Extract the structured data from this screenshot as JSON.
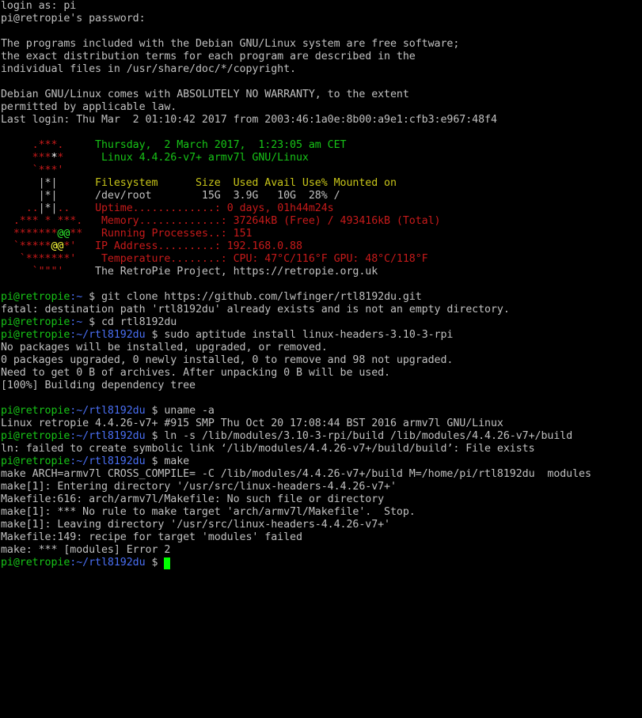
{
  "colors": {
    "background": "#000000",
    "text": "#c0c0c0",
    "prompt_user": "#17c417",
    "prompt_path": "#4a6ff4",
    "logo_red": "#c61a1a",
    "header_yellow": "#c7c419",
    "cursor": "#00ff00"
  },
  "terminal": {
    "lines": [
      [
        {
          "t": "login as: pi",
          "c": "gray"
        }
      ],
      [
        {
          "t": "pi@retropie's password:",
          "c": "gray"
        }
      ],
      [],
      [
        {
          "t": "The programs included with the Debian GNU/Linux system are free software;",
          "c": "gray"
        }
      ],
      [
        {
          "t": "the exact distribution terms for each program are described in the",
          "c": "gray"
        }
      ],
      [
        {
          "t": "individual files in /usr/share/doc/*/copyright.",
          "c": "gray"
        }
      ],
      [],
      [
        {
          "t": "Debian GNU/Linux comes with ABSOLUTELY NO WARRANTY, to the extent",
          "c": "gray"
        }
      ],
      [
        {
          "t": "permitted by applicable law.",
          "c": "gray"
        }
      ],
      [
        {
          "t": "Last login: Thu Mar  2 01:10:42 2017 from 2003:46:1a0e:8b00:a9e1:cfb3:e967:48f4",
          "c": "gray"
        }
      ],
      [],
      [
        {
          "t": "     .***.     ",
          "c": "red"
        },
        {
          "t": "Thursday,  2 March 2017,  1:23:05 am CET",
          "c": "green"
        }
      ],
      [
        {
          "t": "     ***",
          "c": "red"
        },
        {
          "t": "*",
          "c": "white"
        },
        {
          "t": "*      ",
          "c": "red"
        },
        {
          "t": "Linux 4.4.26-v7+ armv7l GNU/Linux",
          "c": "green"
        }
      ],
      [
        {
          "t": "     `***'",
          "c": "red"
        }
      ],
      [
        {
          "t": "      |*|      ",
          "c": "gray"
        },
        {
          "t": "Filesystem      Size  Used Avail Use% Mounted on",
          "c": "yellow"
        }
      ],
      [
        {
          "t": "      |*|      ",
          "c": "gray"
        },
        {
          "t": "/dev/root        15G  3.9G   10G  28% /",
          "c": "gray"
        }
      ],
      [
        {
          "t": "    ..",
          "c": "red"
        },
        {
          "t": "|*|",
          "c": "gray"
        },
        {
          "t": "..    ",
          "c": "red"
        },
        {
          "t": "Uptime.............: 0 days, 01h44m24s",
          "c": "red"
        }
      ],
      [
        {
          "t": "  .*** * ***.   ",
          "c": "red"
        },
        {
          "t": "Memory.............: 37264kB (Free) / 493416kB (Total)",
          "c": "red"
        }
      ],
      [
        {
          "t": "  *******",
          "c": "red"
        },
        {
          "t": "@@",
          "c": "bgreen"
        },
        {
          "t": "**   ",
          "c": "red"
        },
        {
          "t": "Running Processes..: 151",
          "c": "red"
        }
      ],
      [
        {
          "t": "  `*****",
          "c": "red"
        },
        {
          "t": "@@",
          "c": "byellow"
        },
        {
          "t": "*'   ",
          "c": "red"
        },
        {
          "t": "IP Address.........: 192.168.0.88",
          "c": "red"
        }
      ],
      [
        {
          "t": "   `*******'    ",
          "c": "red"
        },
        {
          "t": "Temperature........: CPU: 47°C/116°F GPU: 48°C/118°F",
          "c": "red"
        }
      ],
      [
        {
          "t": "     `\"\"\"'     ",
          "c": "red"
        },
        {
          "t": "The RetroPie Project, https://retropie.org.uk",
          "c": "gray"
        }
      ],
      [],
      [
        {
          "t": "pi@retropie",
          "c": "green"
        },
        {
          "t": ":~ ",
          "c": "blue"
        },
        {
          "t": "$ git clone https://github.com/lwfinger/rtl8192du.git",
          "c": "gray"
        }
      ],
      [
        {
          "t": "fatal: destination path 'rtl8192du' already exists and is not an empty directory.",
          "c": "gray"
        }
      ],
      [
        {
          "t": "pi@retropie",
          "c": "green"
        },
        {
          "t": ":~ ",
          "c": "blue"
        },
        {
          "t": "$ cd rtl8192du",
          "c": "gray"
        }
      ],
      [
        {
          "t": "pi@retropie",
          "c": "green"
        },
        {
          "t": ":~/rtl8192du ",
          "c": "blue"
        },
        {
          "t": "$ sudo aptitude install linux-headers-3.10-3-rpi",
          "c": "gray"
        }
      ],
      [
        {
          "t": "No packages will be installed, upgraded, or removed.",
          "c": "gray"
        }
      ],
      [
        {
          "t": "0 packages upgraded, 0 newly installed, 0 to remove and 98 not upgraded.",
          "c": "gray"
        }
      ],
      [
        {
          "t": "Need to get 0 B of archives. After unpacking 0 B will be used.",
          "c": "gray"
        }
      ],
      [
        {
          "t": "[100%] Building dependency tree",
          "c": "gray"
        }
      ],
      [],
      [
        {
          "t": "pi@retropie",
          "c": "green"
        },
        {
          "t": ":~/rtl8192du ",
          "c": "blue"
        },
        {
          "t": "$ uname -a",
          "c": "gray"
        }
      ],
      [
        {
          "t": "Linux retropie 4.4.26-v7+ #915 SMP Thu Oct 20 17:08:44 BST 2016 armv7l GNU/Linux",
          "c": "gray"
        }
      ],
      [
        {
          "t": "pi@retropie",
          "c": "green"
        },
        {
          "t": ":~/rtl8192du ",
          "c": "blue"
        },
        {
          "t": "$ ln -s /lib/modules/3.10-3-rpi/build /lib/modules/4.4.26-v7+/build",
          "c": "gray"
        }
      ],
      [
        {
          "t": "ln: failed to create symbolic link ‘/lib/modules/4.4.26-v7+/build/build’: File exists",
          "c": "gray"
        }
      ],
      [
        {
          "t": "pi@retropie",
          "c": "green"
        },
        {
          "t": ":~/rtl8192du ",
          "c": "blue"
        },
        {
          "t": "$ make",
          "c": "gray"
        }
      ],
      [
        {
          "t": "make ARCH=armv7l CROSS_COMPILE= -C /lib/modules/4.4.26-v7+/build M=/home/pi/rtl8192du  modules",
          "c": "gray"
        }
      ],
      [
        {
          "t": "make[1]: Entering directory '/usr/src/linux-headers-4.4.26-v7+'",
          "c": "gray"
        }
      ],
      [
        {
          "t": "Makefile:616: arch/armv7l/Makefile: No such file or directory",
          "c": "gray"
        }
      ],
      [
        {
          "t": "make[1]: *** No rule to make target 'arch/armv7l/Makefile'.  Stop.",
          "c": "gray"
        }
      ],
      [
        {
          "t": "make[1]: Leaving directory '/usr/src/linux-headers-4.4.26-v7+'",
          "c": "gray"
        }
      ],
      [
        {
          "t": "Makefile:149: recipe for target 'modules' failed",
          "c": "gray"
        }
      ],
      [
        {
          "t": "make: *** [modules] Error 2",
          "c": "gray"
        }
      ],
      [
        {
          "t": "pi@retropie",
          "c": "green"
        },
        {
          "t": ":~/rtl8192du ",
          "c": "blue"
        },
        {
          "t": "$ ",
          "c": "gray"
        },
        {
          "cursor": true
        }
      ]
    ]
  }
}
